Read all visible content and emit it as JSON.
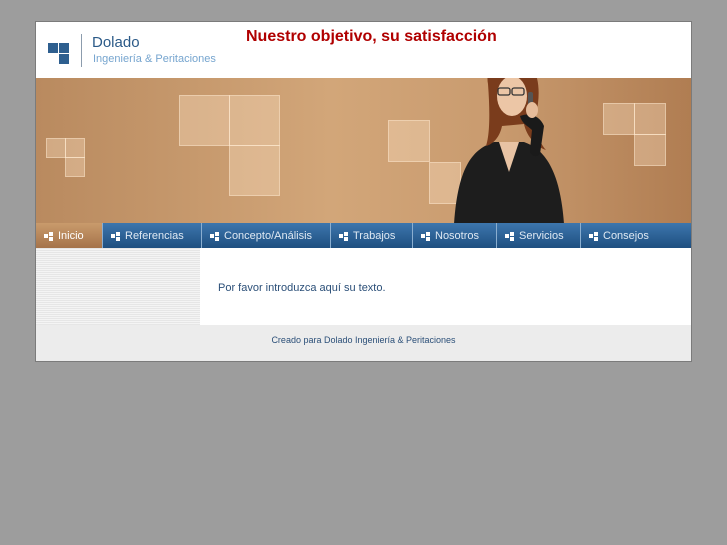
{
  "header": {
    "brand_name": "Dolado",
    "brand_tagline": "Ingeniería & Peritaciones",
    "slogan": "Nuestro objetivo, su satisfacción"
  },
  "nav": {
    "items": [
      {
        "label": "Inicio",
        "active": true
      },
      {
        "label": "Referencias",
        "active": false
      },
      {
        "label": "Concepto/Análisis",
        "active": false
      },
      {
        "label": "Trabajos",
        "active": false
      },
      {
        "label": "Nosotros",
        "active": false
      },
      {
        "label": "Servicios",
        "active": false
      },
      {
        "label": "Consejos",
        "active": false
      }
    ]
  },
  "content": {
    "body_text": "Por favor introduzca aquí su texto."
  },
  "footer": {
    "credit": "Creado para Dolado Ingeniería & Peritaciones"
  },
  "colors": {
    "brand_blue": "#2b5a88",
    "slogan_red": "#b00000",
    "nav_blue": "#2a5f94",
    "nav_active": "#b88658",
    "page_bg": "#9d9d9d"
  }
}
